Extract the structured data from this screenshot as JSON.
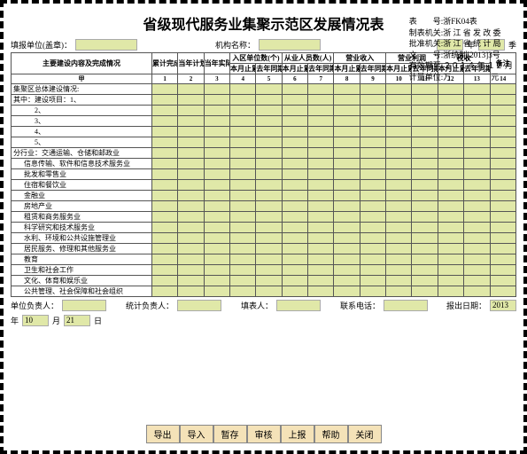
{
  "title": "省级现代服务业集聚示范区发展情况表",
  "meta": {
    "code_l": "表　　号:",
    "code_v": "浙FK04表",
    "made_l": "制表机关:",
    "made_v": "浙 江 省 发 改 委",
    "appr_l": "批准机关:",
    "appr_v": "浙 江 省 统 计 局",
    "doc_l": "文　　号:",
    "doc_v": "浙统制[2013]3号",
    "valid_l": "有效期至:",
    "valid_v": "２０１４ 年 １２ 月",
    "unit_l": "计量单位:",
    "unit_v": "万　　　　　元"
  },
  "header_row": {
    "filler_label": "填报单位(盖章)：",
    "filler_value": "",
    "org_label": "机构名称：",
    "org_value": "",
    "year_suffix": "年",
    "quarter_suffix": "季"
  },
  "head": {
    "main": "主要建设内容及完成情况",
    "g1": "累计完成投资",
    "g2": "当年计划投资",
    "g3": "当年实际完成投资",
    "g4": "入区单位数(个)",
    "g5": "从业人员数(人)",
    "g6": "营业收入",
    "g7": "营业利润",
    "g8": "税收",
    "g9": "备注",
    "sub_a": "本月止累计",
    "sub_b": "去年同期",
    "jia": "甲",
    "nums": [
      "1",
      "2",
      "3",
      "4",
      "5",
      "6",
      "7",
      "8",
      "9",
      "10",
      "11",
      "12",
      "13",
      "14"
    ]
  },
  "rows": [
    {
      "t": "集聚区总体建设情况:",
      "i": 0
    },
    {
      "t": "其中：建设项目：1、",
      "i": 0
    },
    {
      "t": "2、",
      "i": 2
    },
    {
      "t": "3、",
      "i": 2
    },
    {
      "t": "4、",
      "i": 2
    },
    {
      "t": "5、",
      "i": 2
    },
    {
      "t": "分行业：交通运输、仓储和邮政业",
      "i": 0
    },
    {
      "t": "信息传输、软件和信息技术服务业",
      "i": 1
    },
    {
      "t": "批发和零售业",
      "i": 1
    },
    {
      "t": "住宿和餐饮业",
      "i": 1
    },
    {
      "t": "金融业",
      "i": 1
    },
    {
      "t": "房地产业",
      "i": 1
    },
    {
      "t": "租赁和商务服务业",
      "i": 1
    },
    {
      "t": "科学研究和技术服务业",
      "i": 1
    },
    {
      "t": "水利、环境和公共设施管理业",
      "i": 1
    },
    {
      "t": "居民服务、修理和其他服务业",
      "i": 1
    },
    {
      "t": "教育",
      "i": 1
    },
    {
      "t": "卫生和社会工作",
      "i": 1
    },
    {
      "t": "文化、体育和娱乐业",
      "i": 1
    },
    {
      "t": "公共管理、社会保障和社会组织",
      "i": 1
    }
  ],
  "footer": {
    "leader": "单位负责人：",
    "stat": "统计负责人：",
    "filler": "填表人：",
    "phone": "联系电话：",
    "date_l": "报出日期：",
    "year": "2013",
    "m_l": "年",
    "month": "10",
    "d_l": "月",
    "day": "21",
    "day_s": "日"
  },
  "buttons": [
    "导出",
    "导入",
    "暂存",
    "审核",
    "上报",
    "帮助",
    "关闭"
  ]
}
